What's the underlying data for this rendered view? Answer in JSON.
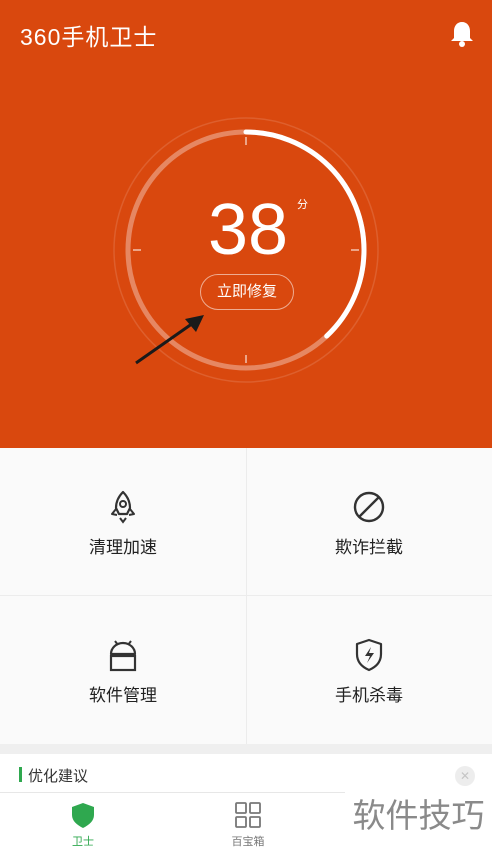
{
  "header": {
    "app_title": "360手机卫士",
    "bell_icon": "bell-icon",
    "background": "#d9480e"
  },
  "score": {
    "value": "38",
    "unit": "分",
    "progress_fraction": 0.38,
    "fix_button_label": "立即修复"
  },
  "features": [
    {
      "label": "清理加速",
      "icon": "rocket-icon"
    },
    {
      "label": "欺诈拦截",
      "icon": "block-icon"
    },
    {
      "label": "软件管理",
      "icon": "android-icon"
    },
    {
      "label": "手机杀毒",
      "icon": "shield-bolt-icon"
    }
  ],
  "suggestion": {
    "title": "优化建议",
    "accent": "#2fa84f"
  },
  "tabs": [
    {
      "label": "卫士",
      "icon": "shield-icon",
      "active": true,
      "color": "#2fa84f"
    },
    {
      "label": "百宝箱",
      "icon": "grid-icon",
      "active": false,
      "color": "#777777"
    }
  ],
  "watermark": "软件技巧"
}
